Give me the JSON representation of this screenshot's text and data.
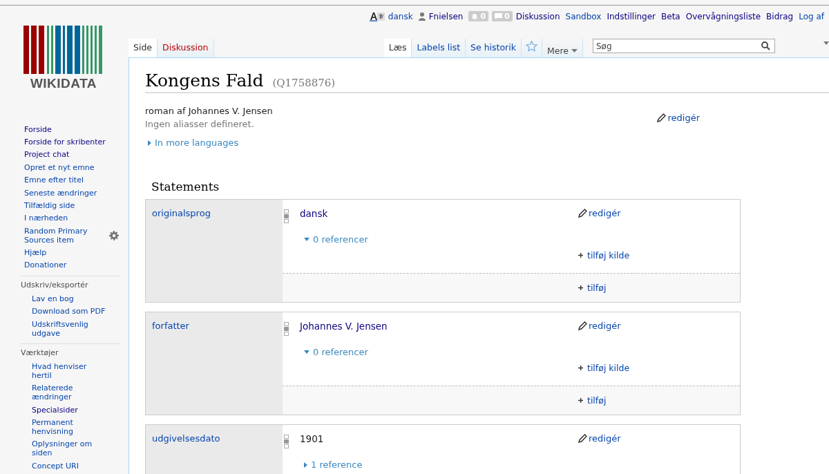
{
  "personal_tools": {
    "language": "dansk",
    "user": "Fnielsen",
    "alerts": "0",
    "notices": "0",
    "links": [
      {
        "label": "Diskussion",
        "visited": true
      },
      {
        "label": "Sandbox",
        "visited": false
      },
      {
        "label": "Indstillinger",
        "visited": true
      },
      {
        "label": "Beta",
        "visited": true
      },
      {
        "label": "Overvågningsliste",
        "visited": true
      },
      {
        "label": "Bidrag",
        "visited": true
      },
      {
        "label": "Log af",
        "visited": false
      }
    ]
  },
  "logo": {
    "wordmark": "WIKIDATA"
  },
  "sidebar": {
    "items": [
      {
        "label": "Forside",
        "visited": true
      },
      {
        "label": "Forside for skribenter",
        "visited": true
      },
      {
        "label": "Project chat",
        "visited": true
      },
      {
        "label": "Opret et nyt emne",
        "visited": false
      },
      {
        "label": "Emne efter titel",
        "visited": false
      },
      {
        "label": "Seneste ændringer",
        "visited": false
      },
      {
        "label": "Tilfældig side",
        "visited": false
      },
      {
        "label": "I nærheden",
        "visited": false
      },
      {
        "label": "Random Primary Sources item",
        "visited": false,
        "settings": true
      },
      {
        "label": "Hjælp",
        "visited": false
      },
      {
        "label": "Donationer",
        "visited": false
      }
    ],
    "sections": [
      {
        "heading": "Udskriv/eksportér",
        "items": [
          {
            "label": "Lav en bog",
            "visited": false
          },
          {
            "label": "Download som PDF",
            "visited": false
          },
          {
            "label": "Udskriftsvenlig udgave",
            "visited": false
          }
        ]
      },
      {
        "heading": "Værktøjer",
        "items": [
          {
            "label": "Hvad henviser hertil",
            "visited": false
          },
          {
            "label": "Relaterede ændringer",
            "visited": false
          },
          {
            "label": "Specialsider",
            "visited": true
          },
          {
            "label": "Permanent henvisning",
            "visited": false
          },
          {
            "label": "Oplysninger om siden",
            "visited": false
          },
          {
            "label": "Concept URI",
            "visited": false
          }
        ]
      }
    ]
  },
  "namespace_tabs": [
    {
      "label": "Side",
      "selected": true,
      "missing": false
    },
    {
      "label": "Diskussion",
      "selected": false,
      "missing": true
    }
  ],
  "view_tabs": [
    {
      "label": "Læs",
      "selected": true
    },
    {
      "label": "Labels list",
      "selected": false
    },
    {
      "label": "Se historik",
      "selected": false
    }
  ],
  "more_menu": "Mere",
  "search": {
    "placeholder": "Søg"
  },
  "title": {
    "label": "Kongens Fald",
    "id": "(Q1758876)"
  },
  "description": "roman af Johannes V. Jensen",
  "aliases": "Ingen aliasser defineret.",
  "edit_link": "redigér",
  "more_languages": "In more languages",
  "statements_heading": "Statements",
  "statements": [
    {
      "property": "originalsprog",
      "value": "dansk",
      "kind": "item",
      "edit": "redigér",
      "references": "0 referencer",
      "expanded": true,
      "add_source": "tilføj kilde",
      "add": "tilføj"
    },
    {
      "property": "forfatter",
      "value": "Johannes V. Jensen",
      "kind": "item",
      "edit": "redigér",
      "references": "0 referencer",
      "expanded": true,
      "add_source": "tilføj kilde",
      "add": "tilføj"
    },
    {
      "property": "udgivelsesdato",
      "value": "1901",
      "kind": "text",
      "edit": "redigér",
      "references": "1 reference",
      "expanded": false
    }
  ]
}
